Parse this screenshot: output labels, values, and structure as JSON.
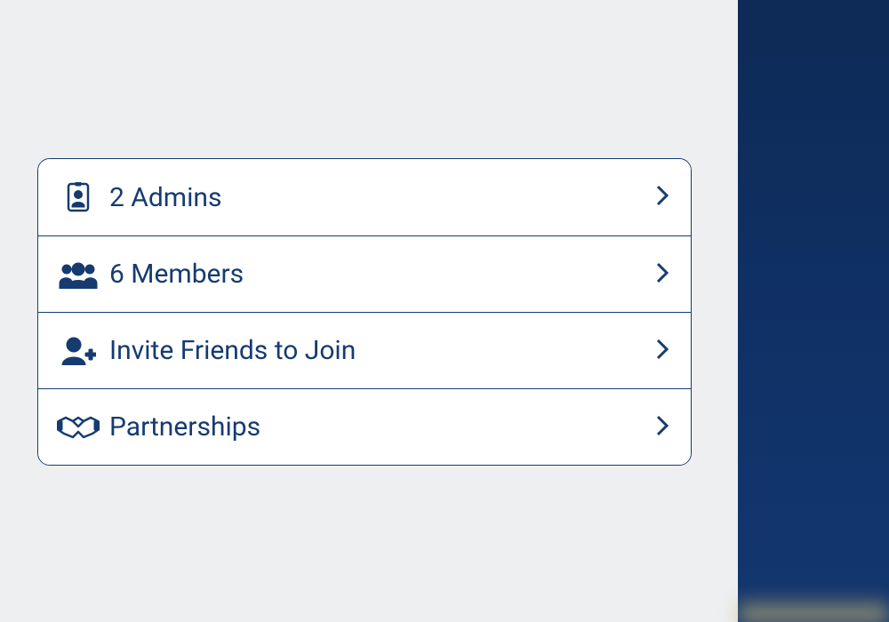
{
  "colors": {
    "primary": "#163b70",
    "panel_bg": "#ffffff",
    "page_bg": "#edeff1",
    "right_bg": "#103068"
  },
  "menu": {
    "items": [
      {
        "icon": "id-badge-icon",
        "label": "2 Admins"
      },
      {
        "icon": "users-icon",
        "label": "6 Members"
      },
      {
        "icon": "user-plus-icon",
        "label": "Invite Friends to Join"
      },
      {
        "icon": "handshake-icon",
        "label": "Partnerships"
      }
    ]
  }
}
